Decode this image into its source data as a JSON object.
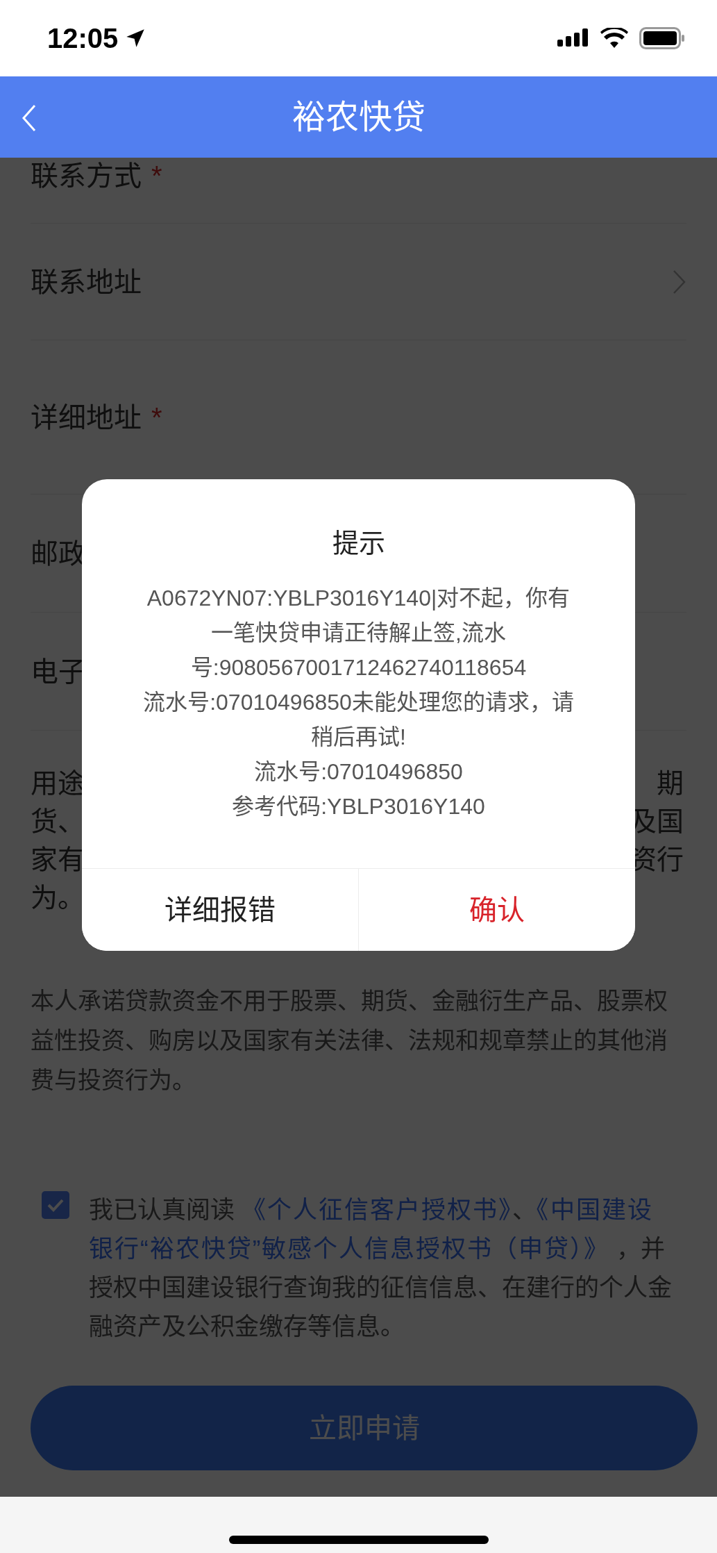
{
  "status_bar": {
    "time": "12:05"
  },
  "nav": {
    "title": "裕农快贷"
  },
  "form": {
    "rows": [
      {
        "label": "联系方式",
        "marker": "*",
        "kind": "text"
      },
      {
        "label": "联系地址",
        "kind": "select"
      },
      {
        "label": "详细地址",
        "marker": "*",
        "kind": "text"
      },
      {
        "label": "邮政",
        "kind": "text"
      },
      {
        "label": "电子",
        "kind": "text"
      }
    ]
  },
  "usage_note": {
    "lines": [
      {
        "left": "用途",
        "right": "期"
      },
      {
        "left": "货、",
        "right": "及国"
      },
      {
        "left": "家有",
        "right": "资行"
      },
      {
        "left": "为。"
      }
    ]
  },
  "promise": "本人承诺贷款资金不用于股票、期货、金融衍生产品、股票权益性投资、购房以及国家有关法律、法规和规章禁止的其他消费与投资行为。",
  "consent": {
    "checked": true,
    "parts": [
      {
        "kind": "text",
        "text": "我已认真阅读 "
      },
      {
        "kind": "link",
        "text": "《个人征信客户授权书》"
      },
      {
        "kind": "text",
        "text": "、"
      },
      {
        "kind": "link",
        "text": "《中国建设"
      },
      {
        "kind": "link",
        "text": "银行“裕农快贷”敏感个人信息授权书（申贷）》"
      },
      {
        "kind": "text",
        "text": " ，并授权中国建设银行查询我的征信信息、在建行的个人金融资产及公积金缴存等信息。"
      }
    ]
  },
  "submit_button": "立即申请",
  "dialog": {
    "title": "提示",
    "lines": [
      "A0672YN07:YBLP3016Y140|对不起，你有",
      "一笔快贷申请正待解止签,流水",
      "号:9080567001712462740118654",
      "流水号:07010496850未能处理您的请求，请",
      "稍后再试!",
      "流水号:07010496850",
      "参考代码:YBLP3016Y140"
    ],
    "buttons": [
      {
        "label": "详细报错",
        "kind": "default"
      },
      {
        "label": "确认",
        "kind": "primary"
      }
    ]
  }
}
